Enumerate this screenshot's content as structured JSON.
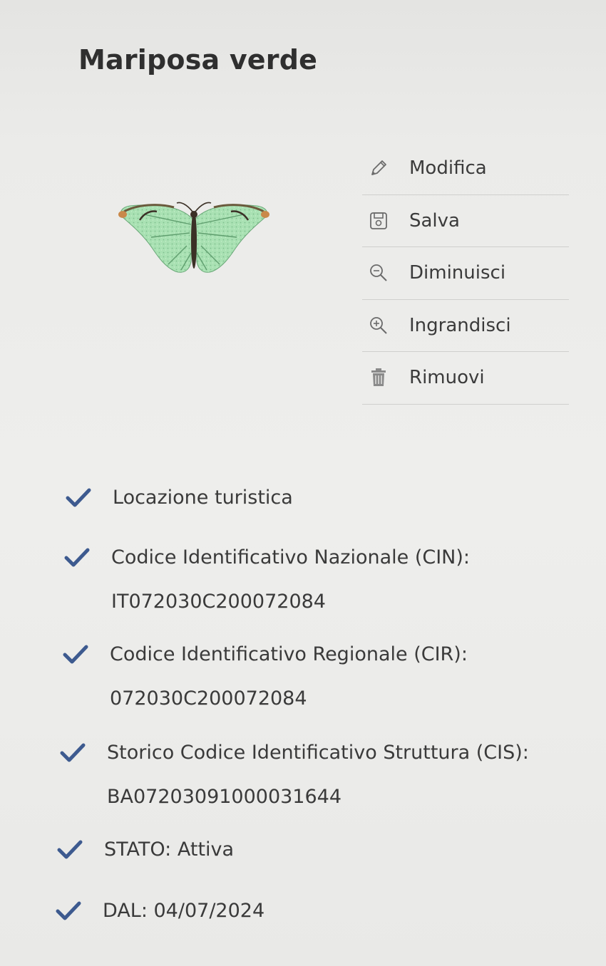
{
  "header": {
    "title": "Mariposa verde"
  },
  "image": {
    "subject_icon": "butterfly-image",
    "wing_color": "#a8e0b2",
    "body_color": "#3b3026"
  },
  "menu": {
    "items": [
      {
        "id": "modifica",
        "label": "Modifica",
        "icon": "pencil-icon"
      },
      {
        "id": "salva",
        "label": "Salva",
        "icon": "save-icon"
      },
      {
        "id": "diminuisci",
        "label": "Diminuisci",
        "icon": "zoom-out-icon"
      },
      {
        "id": "ingrandisci",
        "label": "Ingrandisci",
        "icon": "zoom-in-icon"
      },
      {
        "id": "rimuovi",
        "label": "Rimuovi",
        "icon": "trash-icon"
      }
    ]
  },
  "info": {
    "check_color": "#3d5a8f",
    "items": [
      {
        "line1": "Locazione turistica",
        "line2": ""
      },
      {
        "line1": "Codice Identificativo Nazionale (CIN):",
        "line2": "IT072030C200072084"
      },
      {
        "line1": "Codice Identificativo Regionale (CIR):",
        "line2": "072030C200072084"
      },
      {
        "line1": "Storico Codice Identificativo Struttura (CIS):",
        "line2": "BA07203091000031644"
      },
      {
        "line1": "STATO: Attiva",
        "line2": ""
      },
      {
        "line1": "DAL: 04/07/2024",
        "line2": ""
      }
    ]
  }
}
